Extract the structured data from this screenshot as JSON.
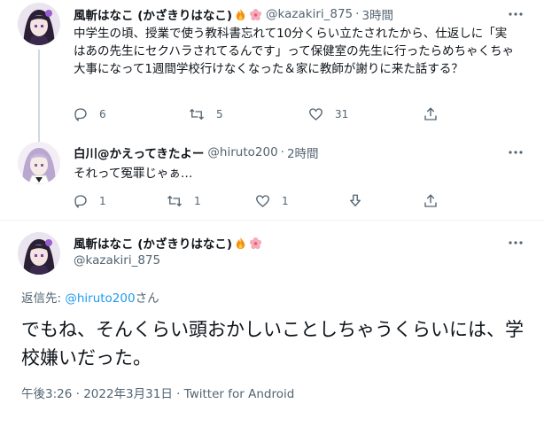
{
  "tweet1": {
    "name": "風斬はなこ (かざきりはなこ)",
    "handle": "@kazakiri_875",
    "time": "3時間",
    "text": "中学生の頃、授業で使う教科書忘れて10分くらい立たされたから、仕返しに「実はあの先生にセクハラされてるんです」って保健室の先生に行ったらめちゃくちゃ大事になって1週間学校行けなくなった＆家に教師が謝りに来た話する？",
    "replies": "6",
    "retweets": "5",
    "likes": "31"
  },
  "tweet2": {
    "name": "白川@かえってきたよー",
    "handle": "@hiruto200",
    "time": "2時間",
    "text": "それって冤罪じゃぁ…",
    "replies": "1",
    "retweets": "1",
    "likes": "1"
  },
  "main": {
    "name": "風斬はなこ (かざきりはなこ)",
    "handle": "@kazakiri_875",
    "reply_prefix": "返信先: ",
    "reply_mention": "@hiruto200",
    "reply_suffix": "さん",
    "text": "でもね、そんくらい頭おかしいことしちゃうくらいには、学校嫌いだった。",
    "timestamp": "午後3:26 · 2022年3月31日 · Twitter for Android"
  },
  "common": {
    "dot": "·"
  },
  "colors": {
    "accent": "#1d9bf0",
    "secondary_text": "#536471",
    "thread_line": "#cfd9de"
  }
}
